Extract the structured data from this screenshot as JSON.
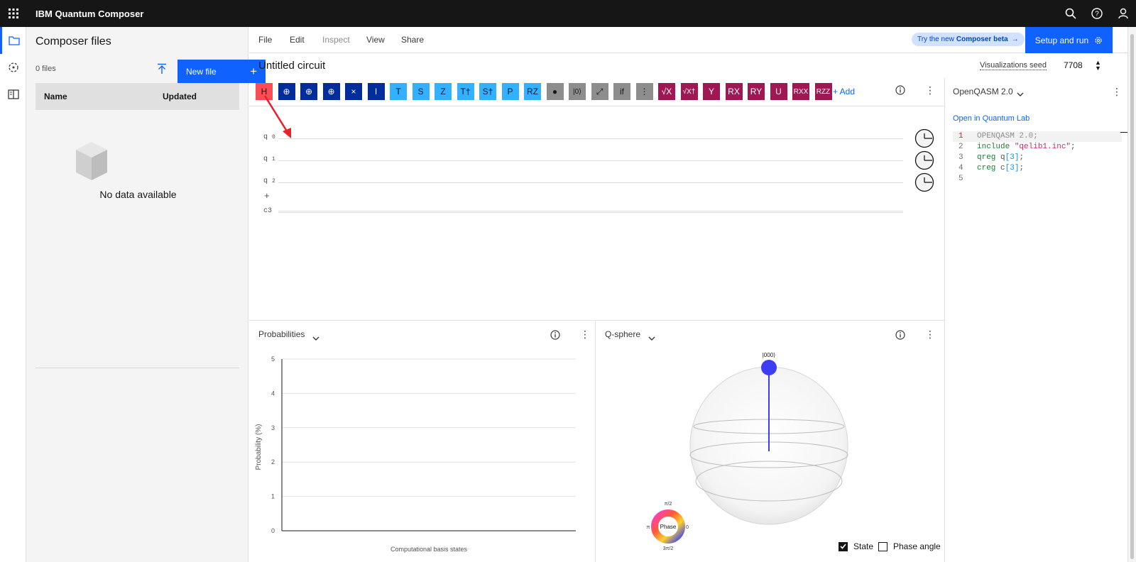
{
  "topbar": {
    "brand": "IBM Quantum Composer",
    "icons": [
      "app-switcher-icon",
      "search-icon",
      "help-icon",
      "user-icon"
    ]
  },
  "sidebar": {
    "title": "Composer files",
    "count": "0 files",
    "new_file_label": "New file",
    "columns": [
      "Name",
      "Updated"
    ],
    "empty_text": "No data available"
  },
  "menu": {
    "items": [
      "File",
      "Edit",
      "Inspect",
      "View",
      "Share"
    ],
    "beta_prefix": "Try the new",
    "beta_bold": "Composer beta",
    "setup_run": "Setup and run"
  },
  "circuit": {
    "title": "Untitled circuit",
    "seed_label": "Visualizations seed",
    "seed_value": "7708",
    "qubits": [
      "q",
      "q",
      "q"
    ],
    "qubit_indices": [
      "0",
      "1",
      "2"
    ],
    "classical": "c3",
    "add_label": "+ Add"
  },
  "gates": [
    {
      "label": "H",
      "kind": "red"
    },
    {
      "label": "⊕",
      "kind": "navy"
    },
    {
      "label": "⊕",
      "kind": "navy"
    },
    {
      "label": "⊕",
      "kind": "navy"
    },
    {
      "label": "×",
      "kind": "navy"
    },
    {
      "label": "I",
      "kind": "navy"
    },
    {
      "label": "T",
      "kind": "sky"
    },
    {
      "label": "S",
      "kind": "sky"
    },
    {
      "label": "Z",
      "kind": "sky"
    },
    {
      "label": "T†",
      "kind": "sky"
    },
    {
      "label": "S†",
      "kind": "sky"
    },
    {
      "label": "P",
      "kind": "sky"
    },
    {
      "label": "RZ",
      "kind": "sky"
    },
    {
      "label": "●",
      "kind": "gray"
    },
    {
      "label": "|0⟩",
      "kind": "gray"
    },
    {
      "label": "⤢",
      "kind": "gray"
    },
    {
      "label": "if",
      "kind": "gray"
    },
    {
      "label": "⋮",
      "kind": "gray"
    },
    {
      "label": "√X",
      "kind": "mag"
    },
    {
      "label": "√X†",
      "kind": "mag"
    },
    {
      "label": "Y",
      "kind": "mag"
    },
    {
      "label": "RX",
      "kind": "mag"
    },
    {
      "label": "RY",
      "kind": "mag"
    },
    {
      "label": "U",
      "kind": "mag"
    },
    {
      "label": "RXX",
      "kind": "mag"
    },
    {
      "label": "RZZ",
      "kind": "mag"
    }
  ],
  "qasm": {
    "title": "OpenQASM 2.0",
    "open_lab": "Open in Quantum Lab",
    "lines": [
      {
        "n": "1",
        "parts": [
          {
            "t": "OPENQASM 2.0;",
            "c": "#8d8d8d"
          }
        ]
      },
      {
        "n": "2",
        "parts": [
          {
            "t": "include ",
            "c": "#198038"
          },
          {
            "t": "\"qelib1.inc\"",
            "c": "#d02670"
          },
          {
            "t": ";",
            "c": "#525252"
          }
        ]
      },
      {
        "n": "3",
        "parts": [
          {
            "t": "qreg ",
            "c": "#198038"
          },
          {
            "t": "q",
            "c": "#525252"
          },
          {
            "t": "[3]",
            "c": "#1192e8"
          },
          {
            "t": ";",
            "c": "#525252"
          }
        ]
      },
      {
        "n": "4",
        "parts": [
          {
            "t": "creg ",
            "c": "#198038"
          },
          {
            "t": "c",
            "c": "#525252"
          },
          {
            "t": "[3]",
            "c": "#1192e8"
          },
          {
            "t": ";",
            "c": "#525252"
          }
        ]
      },
      {
        "n": "5",
        "parts": []
      }
    ]
  },
  "probabilities": {
    "title": "Probabilities",
    "ylabel": "Probability (%)",
    "xlabel": "Computational basis states",
    "ticks": [
      "0",
      "1",
      "2",
      "3",
      "4",
      "5"
    ]
  },
  "qsphere": {
    "title": "Q-sphere",
    "state_label": "|000⟩",
    "phase_center": "Phase",
    "phase_top": "π/2",
    "phase_left": "π",
    "phase_right": "0",
    "phase_bottom": "3π/2",
    "state_checkbox": "State",
    "phase_checkbox": "Phase angle",
    "state_checked": true,
    "phase_checked": false
  },
  "colors": {
    "accent": "#0f62fe",
    "annotation_arrow": "#e8202a"
  }
}
